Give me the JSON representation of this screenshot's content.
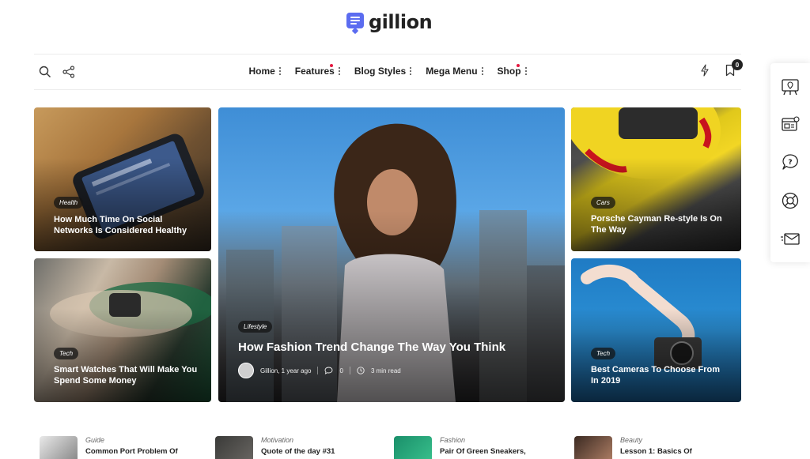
{
  "logo": {
    "text": "gillion"
  },
  "nav": {
    "items": [
      {
        "label": "Home",
        "dot": false
      },
      {
        "label": "Features",
        "dot": true
      },
      {
        "label": "Blog Styles",
        "dot": false
      },
      {
        "label": "Mega Menu",
        "dot": false
      },
      {
        "label": "Shop",
        "dot": true
      }
    ],
    "bookmark_count": "0",
    "left_icons": [
      "search-icon",
      "share-icon"
    ],
    "right_icons": [
      "lightning-icon",
      "bookmark-icon"
    ]
  },
  "side_toolbar": {
    "icons": [
      "demo-monitor-icon",
      "browser-window-icon",
      "help-question-icon",
      "support-lifebuoy-icon",
      "mail-envelope-icon"
    ]
  },
  "cards": {
    "health": {
      "category": "Health",
      "title": "How Much Time On Social Networks Is Considered Healthy"
    },
    "tech_watch": {
      "category": "Tech",
      "title": "Smart Watches That Will Make You Spend Some Money"
    },
    "featured": {
      "category": "Lifestyle",
      "title": "How Fashion Trend Change The Way You Think",
      "author": "Gillion, 1 year ago",
      "comments": "0",
      "read_time": "3 min read"
    },
    "cars": {
      "category": "Cars",
      "title": "Porsche Cayman Re-style Is On The Way"
    },
    "tech_camera": {
      "category": "Tech",
      "title": "Best Cameras To Choose From In 2019"
    }
  },
  "bottom": [
    {
      "category": "Guide",
      "title": "Common Port Problem Of"
    },
    {
      "category": "Motivation",
      "title": "Quote of the day #31"
    },
    {
      "category": "Fashion",
      "title": "Pair Of Green Sneakers,"
    },
    {
      "category": "Beauty",
      "title": "Lesson 1: Basics Of"
    }
  ],
  "colors": {
    "accent": "#5b6cf0",
    "dot": "#e5173f"
  }
}
